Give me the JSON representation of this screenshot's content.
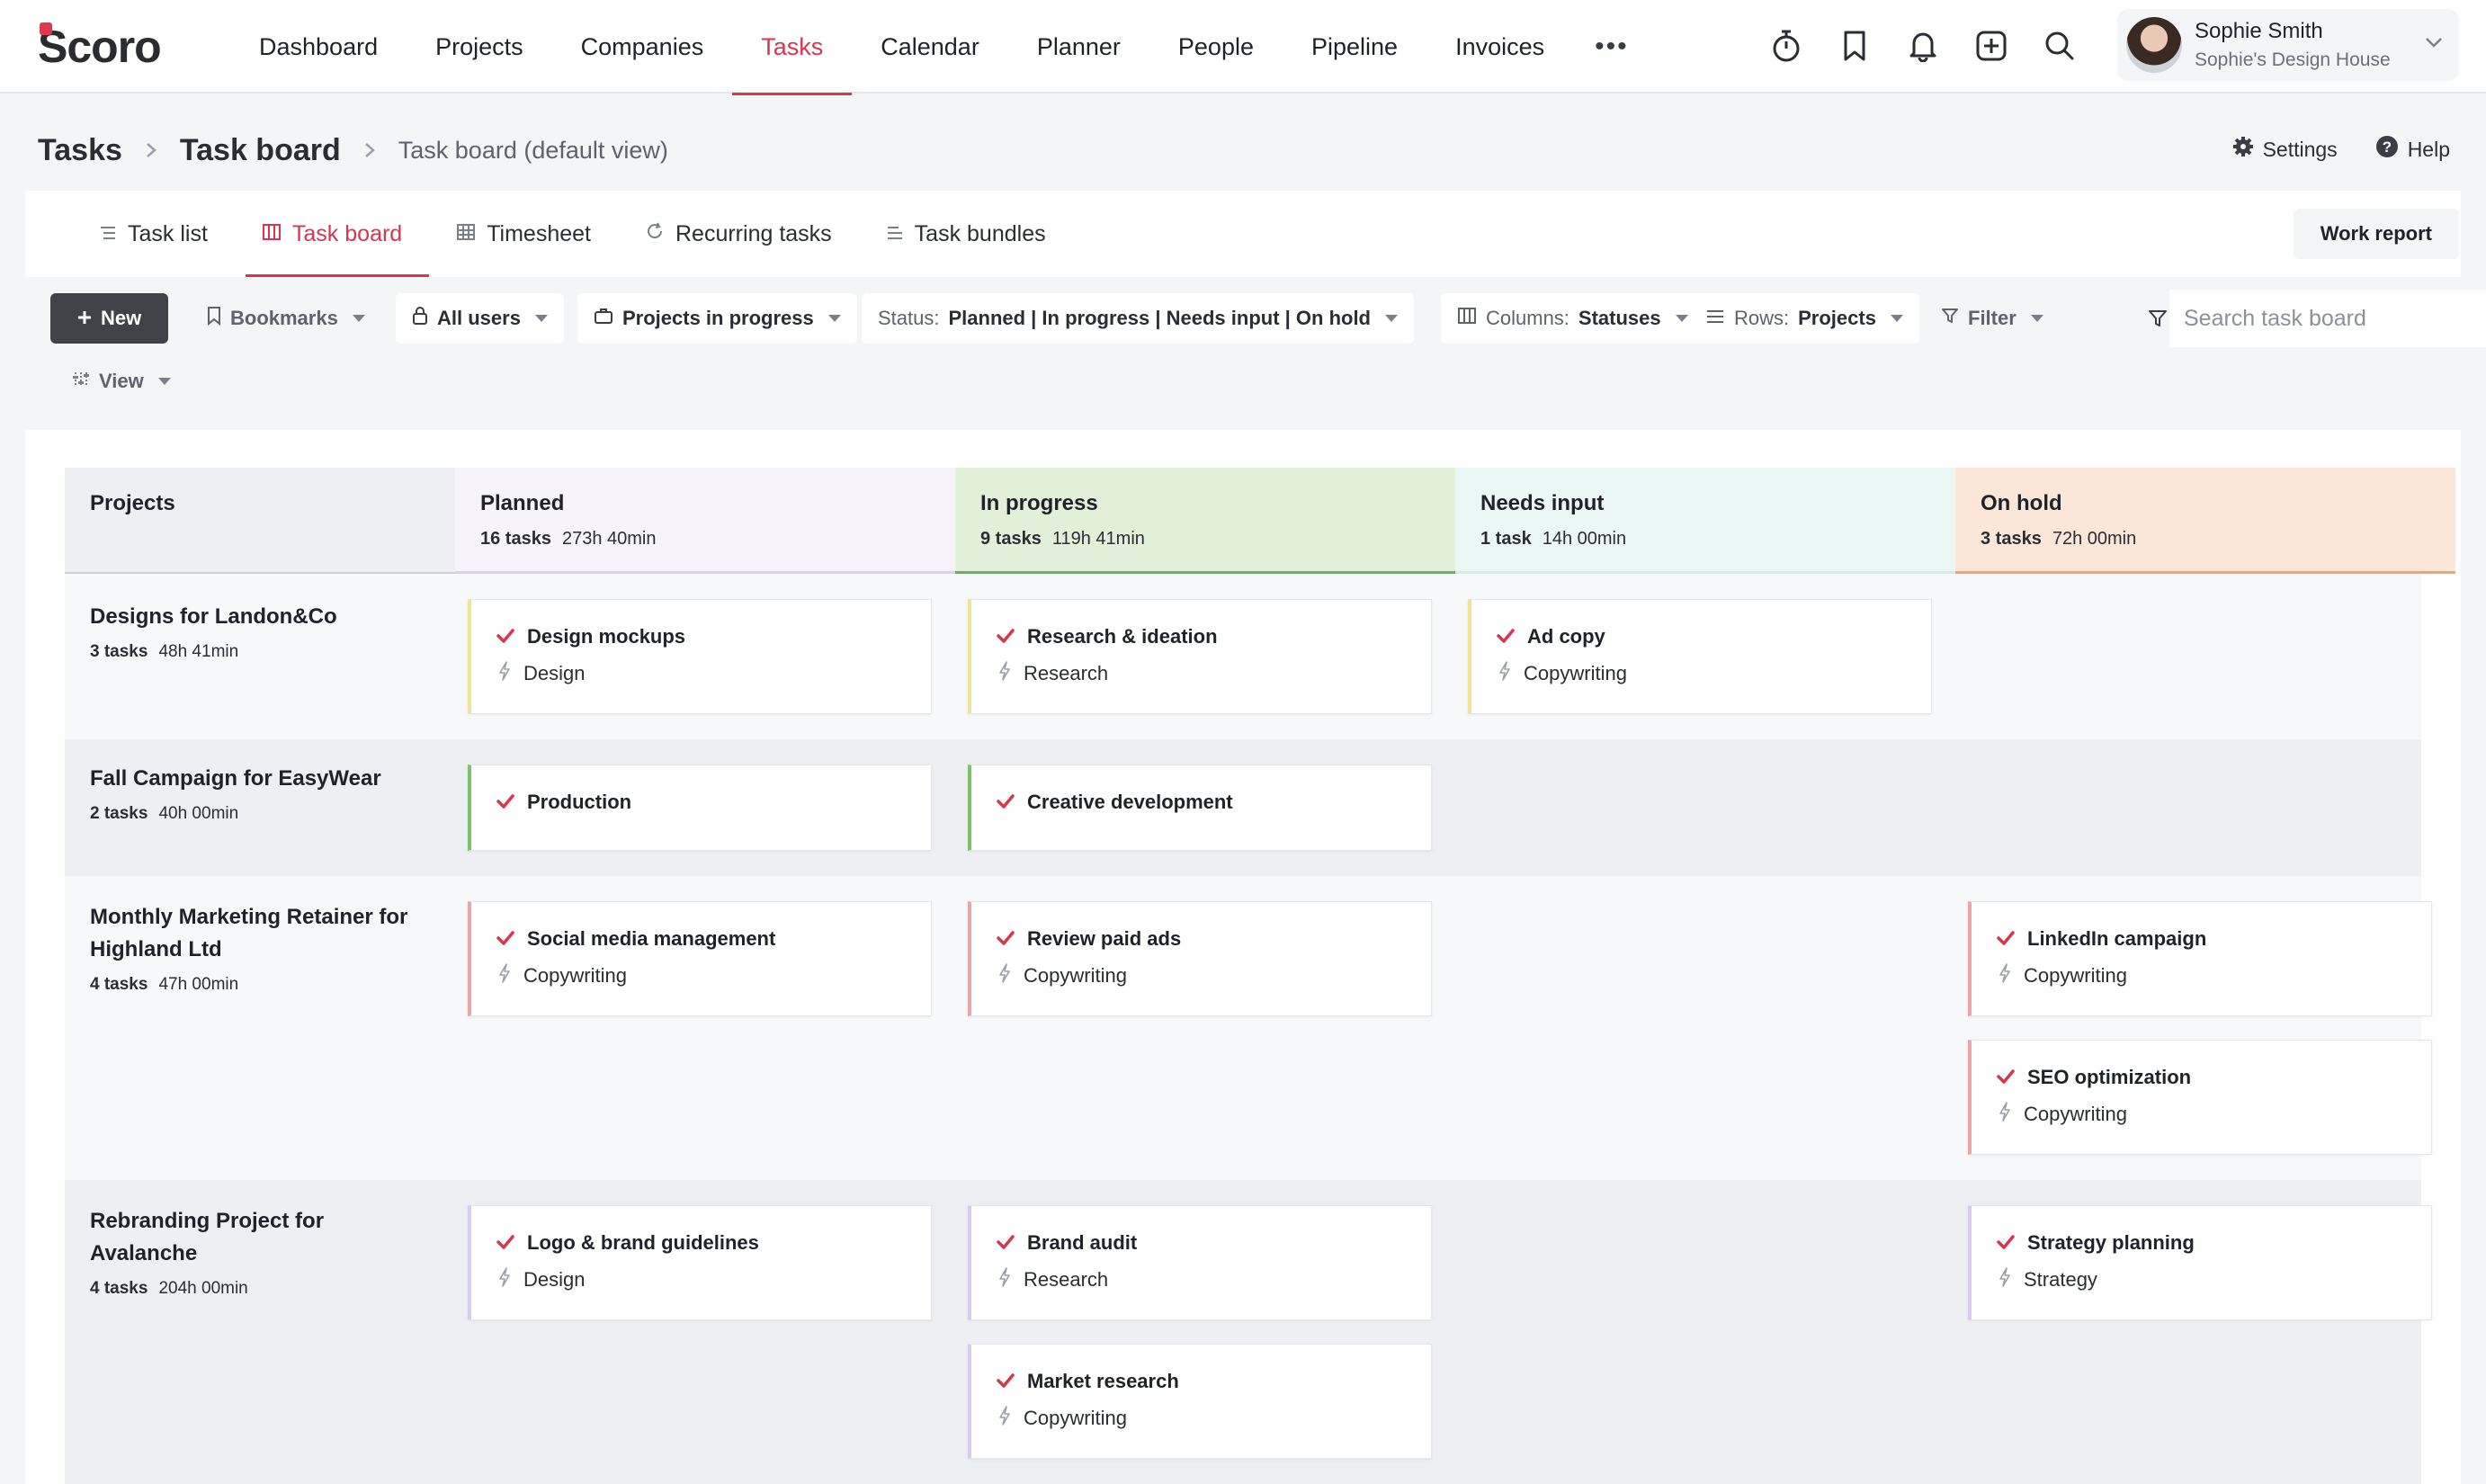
{
  "app": {
    "logo": "Scoro"
  },
  "nav": {
    "items": [
      "Dashboard",
      "Projects",
      "Companies",
      "Tasks",
      "Calendar",
      "Planner",
      "People",
      "Pipeline",
      "Invoices"
    ],
    "active": "Tasks",
    "more": "•••"
  },
  "user": {
    "name": "Sophie Smith",
    "org": "Sophie's Design House"
  },
  "breadcrumb": {
    "root": "Tasks",
    "current": "Task board",
    "view": "Task board (default view)"
  },
  "top_actions": {
    "settings": "Settings",
    "help": "Help"
  },
  "tabs": [
    "Task list",
    "Task board",
    "Timesheet",
    "Recurring tasks",
    "Task bundles"
  ],
  "active_tab": "Task board",
  "work_report": "Work report",
  "toolbar": {
    "new": "New",
    "bookmarks": "Bookmarks",
    "users": "All users",
    "projects": "Projects in progress",
    "status_label": "Status:",
    "status_value": "Planned | In progress | Needs input | On hold",
    "columns_label": "Columns:",
    "columns_value": "Statuses",
    "rows_label": "Rows:",
    "rows_value": "Projects",
    "filter": "Filter",
    "view": "View",
    "search_placeholder": "Search task board"
  },
  "board": {
    "projects_header": "Projects",
    "columns": [
      {
        "title": "Planned",
        "count": "16 tasks",
        "time": "273h 40min",
        "bg": "#f6f3fb",
        "line": "#ddd0ee"
      },
      {
        "title": "In progress",
        "count": "9 tasks",
        "time": "119h 41min",
        "bg": "#e2efd9",
        "line": "#6bb35a"
      },
      {
        "title": "Needs input",
        "count": "1 task",
        "time": "14h 00min",
        "bg": "#eaf7f4",
        "line": "#d3ece5"
      },
      {
        "title": "On hold",
        "count": "3 tasks",
        "time": "72h 00min",
        "bg": "#fbe6d7",
        "line": "#f0a56e"
      }
    ],
    "rows": [
      {
        "title": "Designs for Landon&Co",
        "count": "3 tasks",
        "time": "48h 41min",
        "tasks": [
          {
            "col": 0,
            "slot": 0,
            "title": "Design mockups",
            "type": "Design",
            "accent": "#f2e39a"
          },
          {
            "col": 1,
            "slot": 0,
            "title": "Research & ideation",
            "type": "Research",
            "accent": "#f2e39a"
          },
          {
            "col": 2,
            "slot": 0,
            "title": "Ad copy",
            "type": "Copywriting",
            "accent": "#f2e39a"
          }
        ]
      },
      {
        "title": "Fall Campaign for EasyWear",
        "count": "2 tasks",
        "time": "40h 00min",
        "tasks": [
          {
            "col": 0,
            "slot": 0,
            "title": "Production",
            "type": "",
            "accent": "#7cc36a"
          },
          {
            "col": 1,
            "slot": 0,
            "title": "Creative development",
            "type": "",
            "accent": "#7cc36a"
          }
        ]
      },
      {
        "title": "Monthly Marketing Retainer for Highland Ltd",
        "count": "4 tasks",
        "time": "47h 00min",
        "tasks": [
          {
            "col": 0,
            "slot": 0,
            "title": "Social media management",
            "type": "Copywriting",
            "accent": "#e9a6ab"
          },
          {
            "col": 1,
            "slot": 0,
            "title": "Review paid ads",
            "type": "Copywriting",
            "accent": "#e9a6ab"
          },
          {
            "col": 3,
            "slot": 0,
            "title": "LinkedIn campaign",
            "type": "Copywriting",
            "accent": "#e9a6ab"
          },
          {
            "col": 3,
            "slot": 1,
            "title": "SEO optimization",
            "type": "Copywriting",
            "accent": "#e9a6ab"
          }
        ]
      },
      {
        "title": "Rebranding Project for Avalanche",
        "count": "4 tasks",
        "time": "204h 00min",
        "tasks": [
          {
            "col": 0,
            "slot": 0,
            "title": "Logo & brand guidelines",
            "type": "Design",
            "accent": "#d8cdf0"
          },
          {
            "col": 1,
            "slot": 0,
            "title": "Brand audit",
            "type": "Research",
            "accent": "#d8cdf0"
          },
          {
            "col": 3,
            "slot": 0,
            "title": "Strategy planning",
            "type": "Strategy",
            "accent": "#d8cdf0"
          },
          {
            "col": 1,
            "slot": 1,
            "title": "Market research",
            "type": "Copywriting",
            "accent": "#d8cdf0"
          }
        ]
      }
    ]
  },
  "colors": {
    "accent": "#d8364c",
    "check": "#d8364c"
  }
}
